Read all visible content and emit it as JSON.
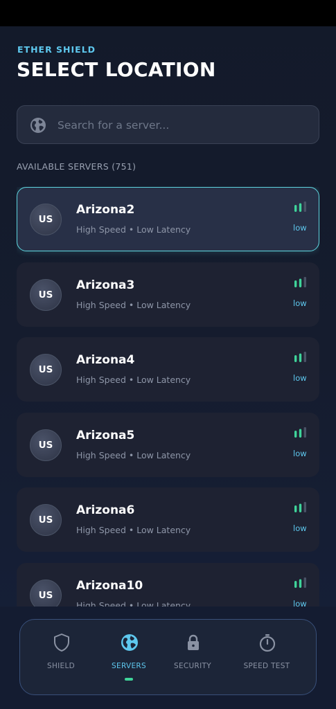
{
  "app": {
    "brand": "ETHER SHIELD",
    "title": "SELECT LOCATION"
  },
  "search": {
    "placeholder": "Search for a server...",
    "value": "",
    "icon": "globe-icon"
  },
  "section_label": "AVAILABLE SERVERS (751)",
  "servers": [
    {
      "code": "US",
      "name": "Arizona2",
      "subtitle": "High Speed • Low Latency",
      "ping": "low",
      "selected": true
    },
    {
      "code": "US",
      "name": "Arizona3",
      "subtitle": "High Speed • Low Latency",
      "ping": "low",
      "selected": false
    },
    {
      "code": "US",
      "name": "Arizona4",
      "subtitle": "High Speed • Low Latency",
      "ping": "low",
      "selected": false
    },
    {
      "code": "US",
      "name": "Arizona5",
      "subtitle": "High Speed • Low Latency",
      "ping": "low",
      "selected": false
    },
    {
      "code": "US",
      "name": "Arizona6",
      "subtitle": "High Speed • Low Latency",
      "ping": "low",
      "selected": false
    },
    {
      "code": "US",
      "name": "Arizona10",
      "subtitle": "High Speed • Low Latency",
      "ping": "low",
      "selected": false
    }
  ],
  "nav": {
    "tabs": [
      {
        "label": "SHIELD",
        "icon": "shield-icon",
        "active": false
      },
      {
        "label": "SERVERS",
        "icon": "globe-icon",
        "active": true
      },
      {
        "label": "SECURITY",
        "icon": "lock-icon",
        "active": false
      },
      {
        "label": "SPEED TEST",
        "icon": "stopwatch-icon",
        "active": false
      }
    ]
  },
  "colors": {
    "accent": "#5ec8ee",
    "signal": "#3fd49a",
    "selected_border": "#5fd6e0",
    "card_bg": "#1e2232",
    "background": "#131a2a"
  }
}
